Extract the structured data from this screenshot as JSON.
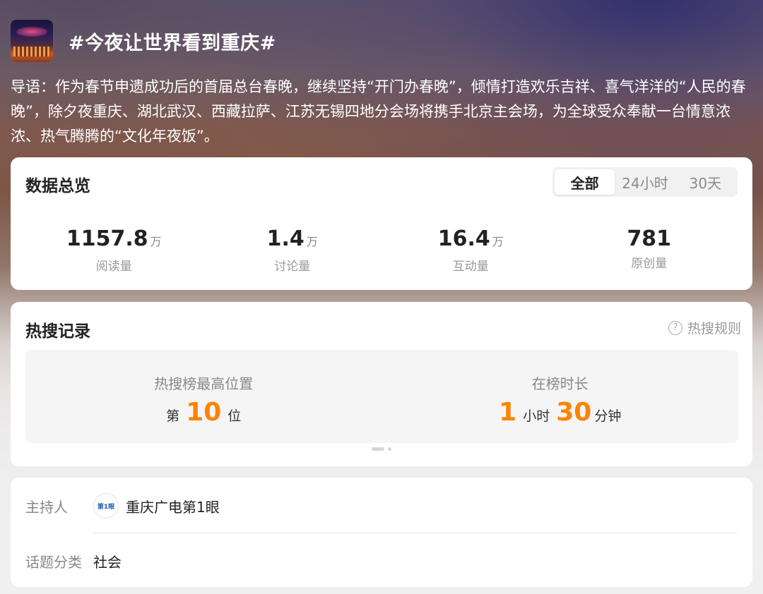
{
  "topic": {
    "title": "#今夜让世界看到重庆#",
    "intro": "导语：作为春节申遗成功后的首届总台春晚，继续坚持“开门办春晚”，倾情打造欢乐吉祥、喜气洋洋的“人民的春晚”，除夕夜重庆、湖北武汉、西藏拉萨、江苏无锡四地分会场将携手北京主会场，为全球受众奉献一台情意浓浓、热气腾腾的“文化年夜饭”。"
  },
  "overview": {
    "title": "数据总览",
    "tabs": [
      "全部",
      "24小时",
      "30天"
    ],
    "active_tab": "全部",
    "stats": [
      {
        "value": "1157.8",
        "unit": "万",
        "label": "阅读量"
      },
      {
        "value": "1.4",
        "unit": "万",
        "label": "讨论量"
      },
      {
        "value": "16.4",
        "unit": "万",
        "label": "互动量"
      },
      {
        "value": "781",
        "unit": "",
        "label": "原创量"
      }
    ]
  },
  "hot": {
    "title": "热搜记录",
    "rules_label": "热搜规则",
    "peak_label": "热搜榜最高位置",
    "peak_prefix": "第",
    "peak_value": "10",
    "peak_suffix": "位",
    "duration_label": "在榜时长",
    "duration_hours": "1",
    "duration_hours_unit": "小时",
    "duration_minutes": "30",
    "duration_minutes_unit": "分钟"
  },
  "info": {
    "host_label": "主持人",
    "host_name": "重庆广电第1眼",
    "host_avatar_text": "第1眼",
    "category_label": "话题分类",
    "category_value": "社会"
  },
  "colors": {
    "accent_orange": "#ff8200"
  }
}
